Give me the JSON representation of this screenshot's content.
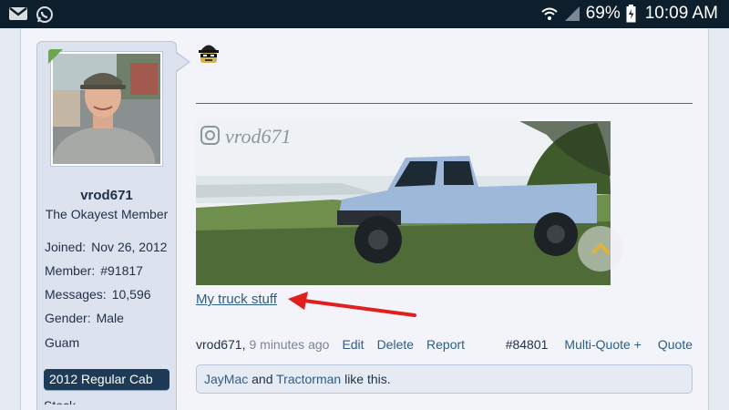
{
  "status_bar": {
    "battery": "69%",
    "time": "10:09 AM",
    "icons": [
      "gmail-icon",
      "whatsapp-icon",
      "wifi-icon",
      "signal-icon",
      "battery-icon"
    ]
  },
  "user": {
    "username": "vrod671",
    "title": "The Okayest Member",
    "stats": [
      {
        "label": "Joined:",
        "value": "Nov 26, 2012"
      },
      {
        "label": "Member:",
        "value": "#91817"
      },
      {
        "label": "Messages:",
        "value": "10,596"
      },
      {
        "label": "Gender:",
        "value": "Male"
      },
      {
        "label": "Guam",
        "value": ""
      }
    ],
    "banner": "2012 Regular Cab",
    "extra": "Stock"
  },
  "post": {
    "image_watermark": "vrod671",
    "link_text": "My truck stuff",
    "author": "vrod671",
    "time_ago": "9 minutes ago",
    "actions": [
      "Edit",
      "Delete",
      "Report"
    ],
    "post_number": "#84801",
    "multi_quote": "Multi-Quote +",
    "quote": "Quote",
    "likes": {
      "user1": "JayMac",
      "and": "and",
      "user2": "Tractorman",
      "suffix": "like this."
    }
  },
  "colors": {
    "status_bar": "#0d1e2c",
    "banner": "#1d3b57",
    "link": "#2d5e86",
    "arrow": "#e0201e"
  }
}
